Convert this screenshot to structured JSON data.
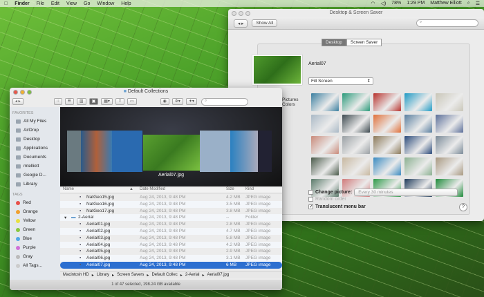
{
  "menubar": {
    "apple": "",
    "items": [
      "Finder",
      "File",
      "Edit",
      "View",
      "Go",
      "Window",
      "Help"
    ],
    "status": {
      "battery": "78%",
      "time": "1:29 PM",
      "user": "Matthew Elliott"
    }
  },
  "prefs": {
    "title": "Desktop & Screen Saver",
    "show_all": "Show All",
    "search_placeholder": "",
    "tabs": [
      "Desktop",
      "Screen Saver"
    ],
    "active_tab": "Desktop",
    "wallpaper_name": "Aerial07",
    "fit": "Fill Screen",
    "sources": [
      "Pictures",
      "Colors"
    ],
    "grid_colors": [
      "#3b7fa0",
      "#2a9a7a",
      "#b8332e",
      "#1f9ac4",
      "#c9c6b8",
      "#aab9c6",
      "#3e4a50",
      "#e0703a",
      "#5a7fa0",
      "#5c6f9a",
      "#c98a7a",
      "#9aa0a4",
      "#8c7a5a",
      "#2a4a7a",
      "#7a8a98",
      "#4a5a4a",
      "#c8b8a0",
      "#3a8ac0",
      "#8ab090",
      "#a89880",
      "#5a7a6a",
      "#d07a7a",
      "#2e9a4a",
      "#1e3a5a",
      "#1e8a3a"
    ],
    "change_picture": {
      "label": "Change picture:",
      "checked": false,
      "interval": "Every 30 minutes"
    },
    "random_order": {
      "label": "Random order",
      "checked": false
    },
    "translucent": {
      "label": "Translucent menu bar",
      "checked": true
    },
    "help": "?"
  },
  "finder": {
    "title": "Default Collections",
    "search_placeholder": "",
    "favorites_header": "FAVORITES",
    "favorites": [
      "All My Files",
      "AirDrop",
      "Desktop",
      "Applications",
      "Documents",
      "mtelliott",
      "Google D...",
      "Library"
    ],
    "tags_header": "TAGS",
    "tags": [
      {
        "name": "Red",
        "color": "#e8504a"
      },
      {
        "name": "Orange",
        "color": "#f0a030"
      },
      {
        "name": "Yellow",
        "color": "#e8e040"
      },
      {
        "name": "Green",
        "color": "#8ac840"
      },
      {
        "name": "Blue",
        "color": "#50a8e8"
      },
      {
        "name": "Purple",
        "color": "#d070d8"
      },
      {
        "name": "Gray",
        "color": "#bbbbbb"
      },
      {
        "name": "All Tags...",
        "color": "#cccccc"
      }
    ],
    "coverflow_caption": "Aerial07.jpg",
    "columns": {
      "name": "Name",
      "date": "Date Modified",
      "size": "Size",
      "kind": "Kind"
    },
    "rows": [
      {
        "name": "NatGeo15.jpg",
        "date": "Aug 24, 2013, 9:48 PM",
        "size": "4.2 MB",
        "kind": "JPEG image"
      },
      {
        "name": "NatGeo16.jpg",
        "date": "Aug 24, 2013, 9:48 PM",
        "size": "3.5 MB",
        "kind": "JPEG image"
      },
      {
        "name": "NatGeo17.jpg",
        "date": "Aug 24, 2013, 9:48 PM",
        "size": "3.8 MB",
        "kind": "JPEG image"
      },
      {
        "name": "2-Aerial",
        "date": "Aug 24, 2013, 9:48 PM",
        "size": "--",
        "kind": "Folder",
        "folder": true
      },
      {
        "name": "Aerial01.jpg",
        "date": "Aug 24, 2013, 9:48 PM",
        "size": "2.8 MB",
        "kind": "JPEG image"
      },
      {
        "name": "Aerial02.jpg",
        "date": "Aug 24, 2013, 9:48 PM",
        "size": "4.7 MB",
        "kind": "JPEG image"
      },
      {
        "name": "Aerial03.jpg",
        "date": "Aug 24, 2013, 9:48 PM",
        "size": "5.8 MB",
        "kind": "JPEG image"
      },
      {
        "name": "Aerial04.jpg",
        "date": "Aug 24, 2013, 9:48 PM",
        "size": "4.2 MB",
        "kind": "JPEG image"
      },
      {
        "name": "Aerial05.jpg",
        "date": "Aug 24, 2013, 9:48 PM",
        "size": "2.9 MB",
        "kind": "JPEG image"
      },
      {
        "name": "Aerial06.jpg",
        "date": "Aug 24, 2013, 9:48 PM",
        "size": "3.1 MB",
        "kind": "JPEG image"
      },
      {
        "name": "Aerial07.jpg",
        "date": "Aug 24, 2013, 9:48 PM",
        "size": "6 MB",
        "kind": "JPEG image",
        "selected": true
      }
    ],
    "path": [
      "Macintosh HD",
      "Library",
      "Screen Savers",
      "Default Collec",
      "2-Aerial",
      "Aerial07.jpg"
    ],
    "status": "1 of 47 selected, 198.24 GB available"
  }
}
